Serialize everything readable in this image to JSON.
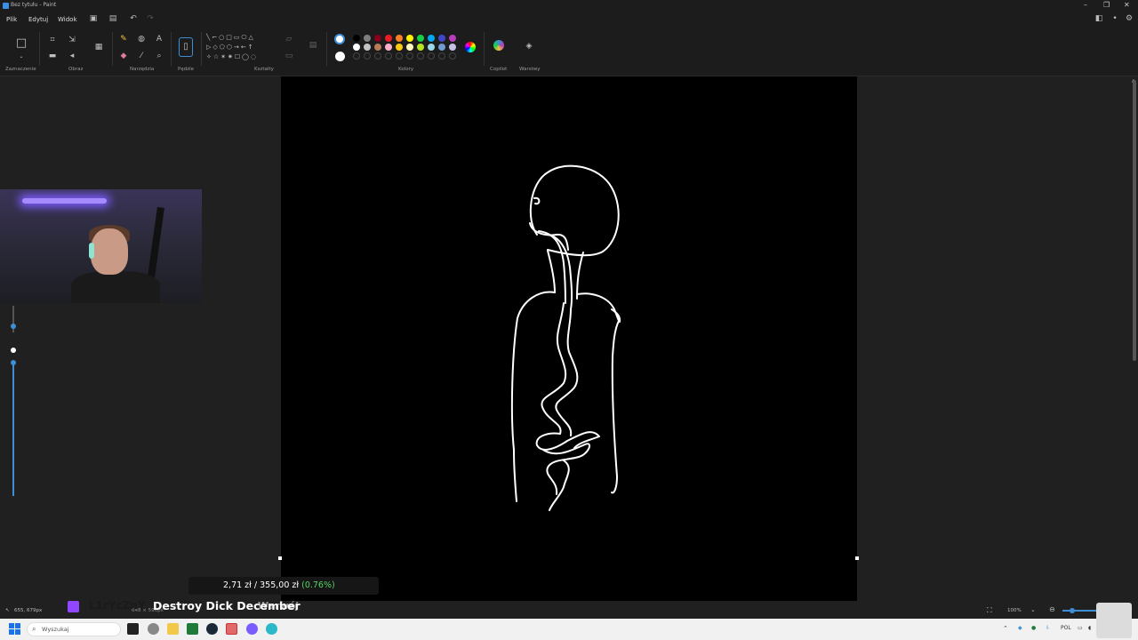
{
  "window": {
    "title": "Bez tytułu - Paint"
  },
  "menu": {
    "file": "Plik",
    "edit": "Edytuj",
    "view": "Widok"
  },
  "ribbon": {
    "groups": {
      "selection": "Zaznaczenie",
      "image": "Obraz",
      "tools": "Narzędzia",
      "brushes": "Pędzle",
      "shapes": "Kształty",
      "colors": "Kolory",
      "copilot": "Copilot",
      "layers": "Warstwy"
    },
    "palette": [
      "#000000",
      "#7f7f7f",
      "#88001b",
      "#ec1c24",
      "#ff7f27",
      "#fff200",
      "#0ed145",
      "#00a8f3",
      "#3f48cc",
      "#b83dba",
      "#ffffff",
      "#c3c3c3",
      "#b97a57",
      "#ffaec9",
      "#ffc90e",
      "#fff9bd",
      "#b5e61d",
      "#99d9ea",
      "#709ad1",
      "#c8bfe7"
    ]
  },
  "statusbar": {
    "coords": "655, 679px",
    "size": "648 × 590px",
    "zoom": "100%"
  },
  "donation": {
    "current": "2,71 zł",
    "separator": "/",
    "goal": "355,00 zł",
    "percent": "(0.76%)"
  },
  "overlay": {
    "channel": "L1rYcZnY",
    "title": "Destroy Dick December",
    "subtitle": "Warwój"
  },
  "taskbar": {
    "search_placeholder": "Wyszukaj",
    "lang": "POL"
  }
}
